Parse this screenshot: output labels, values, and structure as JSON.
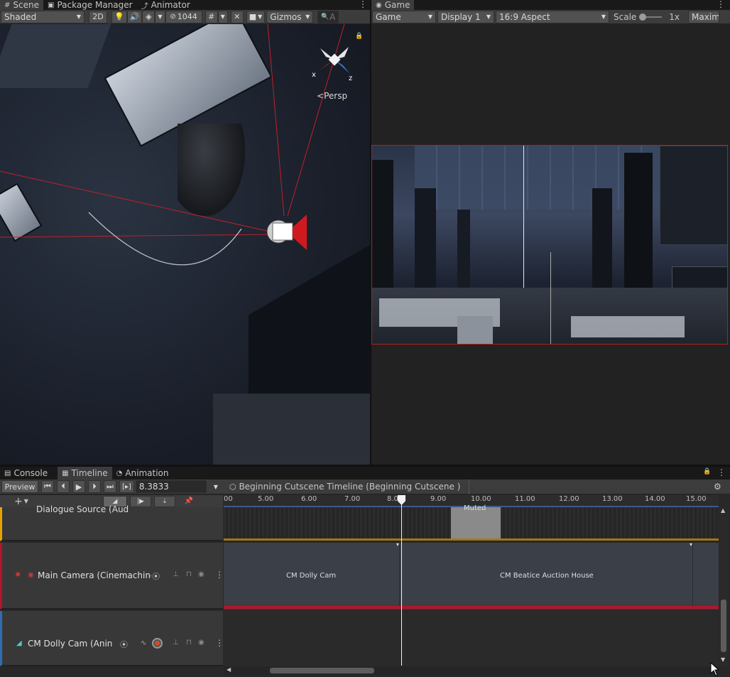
{
  "top_tabs_left": [
    {
      "label": "Scene",
      "icon": "grid-icon"
    },
    {
      "label": "Package Manager",
      "icon": "package-icon"
    },
    {
      "label": "Animator",
      "icon": "animator-icon"
    }
  ],
  "top_tabs_right": [
    {
      "label": "Game",
      "icon": "gamepad-icon"
    }
  ],
  "scene_toolbar": {
    "shading": "Shaded",
    "mode_2d": "2D",
    "hidden_count": "1044",
    "gizmos": "Gizmos",
    "search_placeholder": "A"
  },
  "scene_gizmo": {
    "x_label": "x",
    "z_label": "z",
    "projection": "Persp"
  },
  "game_toolbar": {
    "game_dropdown": "Game",
    "display": "Display 1",
    "aspect": "16:9 Aspect",
    "scale_label": "Scale",
    "scale_value": "1x",
    "maximize": "Maximi"
  },
  "bottom_tabs": [
    {
      "label": "Console",
      "icon": "console-icon"
    },
    {
      "label": "Timeline",
      "icon": "timeline-icon"
    },
    {
      "label": "Animation",
      "icon": "clock-icon"
    }
  ],
  "timeline_toolbar": {
    "preview": "Preview",
    "frame_value": "8.3833",
    "asset_label": "Beginning Cutscene Timeline (Beginning Cutscene )"
  },
  "ruler_ticks": [
    "00",
    "5.00",
    "6.00",
    "7.00",
    "8.00",
    "9.00",
    "10.00",
    "11.00",
    "12.00",
    "13.00",
    "14.00",
    "15.00"
  ],
  "tracks": [
    {
      "name": "Dialogue Source (Audio",
      "accent": "#e8a100"
    },
    {
      "name": "Main Camera (Cinemachine",
      "accent": "#b3152a"
    },
    {
      "name": "CM Dolly Cam (Anin",
      "accent": "#2f6db0"
    }
  ],
  "clips": {
    "muted": "Muted",
    "dolly": "CM Dolly Cam",
    "beatice": "CM Beatice Auction House"
  },
  "colors": {
    "accent_blue": "#46607c",
    "camera_red": "#b3152a",
    "audio_orange": "#e8a100"
  }
}
